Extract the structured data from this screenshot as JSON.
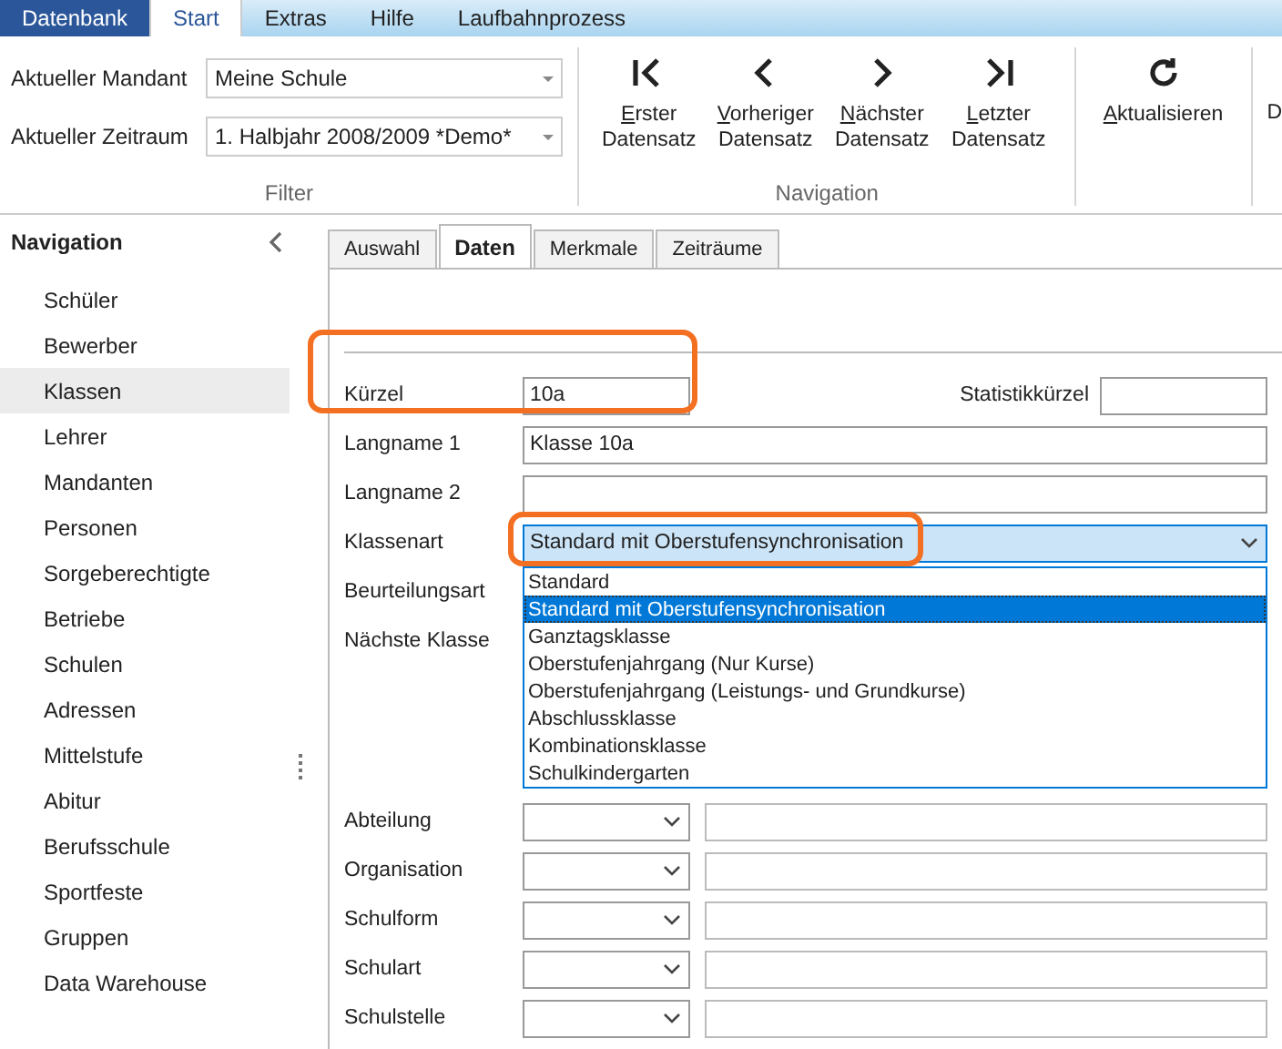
{
  "menu_tabs": [
    {
      "label": "Datenbank",
      "kind": "app",
      "selected": false
    },
    {
      "label": "Start",
      "kind": "tab",
      "selected": true
    },
    {
      "label": "Extras",
      "kind": "tab",
      "selected": false
    },
    {
      "label": "Hilfe",
      "kind": "tab",
      "selected": false
    },
    {
      "label": "Laufbahnprozess",
      "kind": "tab",
      "selected": false
    }
  ],
  "filter": {
    "caption": "Filter",
    "fields": [
      {
        "label": "Aktueller Mandant",
        "value": "Meine Schule"
      },
      {
        "label": "Aktueller Zeitraum",
        "value": "1. Halbjahr 2008/2009 *Demo*"
      }
    ]
  },
  "navigation_group": {
    "caption": "Navigation",
    "buttons": [
      {
        "kind": "first",
        "lines": [
          "Erster",
          "Datensatz"
        ]
      },
      {
        "kind": "prev",
        "lines": [
          "Vorheriger",
          "Datensatz"
        ]
      },
      {
        "kind": "next",
        "lines": [
          "Nächster",
          "Datensatz"
        ]
      },
      {
        "kind": "last",
        "lines": [
          "Letzter",
          "Datensatz"
        ]
      }
    ]
  },
  "refresh": {
    "label": "Aktualisieren"
  },
  "cut_label": "D",
  "sidebar": {
    "title": "Navigation",
    "items": [
      {
        "label": "Schüler",
        "selected": false
      },
      {
        "label": "Bewerber",
        "selected": false
      },
      {
        "label": "Klassen",
        "selected": true
      },
      {
        "label": "Lehrer",
        "selected": false
      },
      {
        "label": "Mandanten",
        "selected": false
      },
      {
        "label": "Personen",
        "selected": false
      },
      {
        "label": "Sorgeberechtigte",
        "selected": false
      },
      {
        "label": "Betriebe",
        "selected": false
      },
      {
        "label": "Schulen",
        "selected": false
      },
      {
        "label": "Adressen",
        "selected": false
      },
      {
        "label": "Mittelstufe",
        "selected": false
      },
      {
        "label": "Abitur",
        "selected": false
      },
      {
        "label": "Berufsschule",
        "selected": false
      },
      {
        "label": "Sportfeste",
        "selected": false
      },
      {
        "label": "Gruppen",
        "selected": false
      },
      {
        "label": "Data Warehouse",
        "selected": false
      }
    ]
  },
  "form_tabs": [
    {
      "label": "Auswahl",
      "selected": false
    },
    {
      "label": "Daten",
      "selected": true
    },
    {
      "label": "Merkmale",
      "selected": false
    },
    {
      "label": "Zeiträume",
      "selected": false
    }
  ],
  "form": {
    "rows": [
      {
        "kind": "short",
        "label": "Kürzel",
        "value": "10a",
        "extra_label": "Statistikkürzel"
      },
      {
        "kind": "text",
        "label": "Langname 1",
        "value": "Klasse 10a"
      },
      {
        "kind": "text",
        "label": "Langname 2"
      },
      {
        "kind": "open_combo",
        "label": "Klassenart",
        "value": "Standard mit Oberstufensynchronisation"
      },
      {
        "kind": "covered",
        "label": "Beurteilungsart"
      },
      {
        "kind": "covered",
        "label": "Nächste Klasse"
      },
      {
        "kind": "combo_pair",
        "label": "Abteilung"
      },
      {
        "kind": "combo_pair",
        "label": "Organisation"
      },
      {
        "kind": "combo_pair",
        "label": "Schulform"
      },
      {
        "kind": "combo_pair",
        "label": "Schulart"
      },
      {
        "kind": "combo_pair",
        "label": "Schulstelle"
      }
    ],
    "dropdown": {
      "options": [
        {
          "label": "Standard",
          "selected": false
        },
        {
          "label": "Standard mit Oberstufensynchronisation",
          "selected": true
        },
        {
          "label": "Ganztagsklasse",
          "selected": false
        },
        {
          "label": "Oberstufenjahrgang (Nur Kurse)",
          "selected": false
        },
        {
          "label": "Oberstufenjahrgang (Leistungs- und Grundkurse)",
          "selected": false
        },
        {
          "label": "Abschlussklasse",
          "selected": false
        },
        {
          "label": "Kombinationsklasse",
          "selected": false
        },
        {
          "label": "Schulkindergarten",
          "selected": false
        }
      ]
    }
  }
}
